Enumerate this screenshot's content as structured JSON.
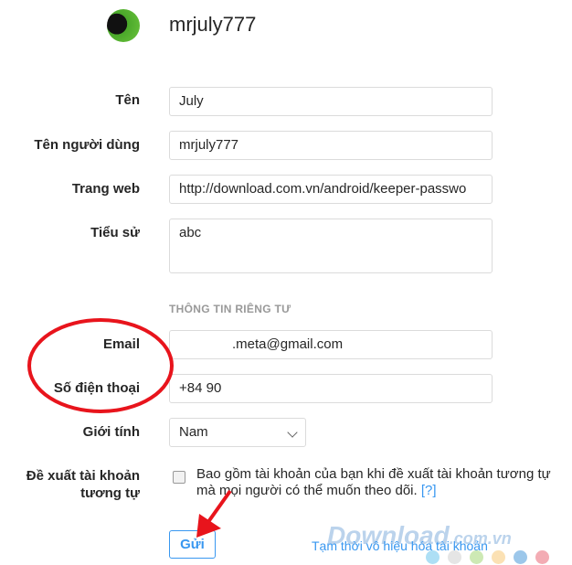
{
  "profile": {
    "username": "mrjuly777"
  },
  "form": {
    "name": {
      "label": "Tên",
      "value": "July"
    },
    "username": {
      "label": "Tên người dùng",
      "value": "mrjuly777"
    },
    "website": {
      "label": "Trang web",
      "value": "http://download.com.vn/android/keeper-passwo"
    },
    "bio": {
      "label": "Tiểu sử",
      "value": "abc"
    },
    "private_header": "THÔNG TIN RIÊNG TƯ",
    "email": {
      "label": "Email",
      "value": ".meta@gmail.com"
    },
    "phone": {
      "label": "Số điện thoại",
      "value": "+84 90"
    },
    "gender": {
      "label": "Giới tính",
      "value": "Nam"
    },
    "suggest": {
      "label_line1": "Đề xuất tài khoản",
      "label_line2": "tương tự",
      "text": "Bao gồm tài khoản của bạn khi đề xuất tài khoản tương tự mà mọi người có thể muốn theo dõi.",
      "help": "[?]",
      "checked": false
    },
    "submit_label": "Gửi",
    "disable_link": "Tạm thời vô hiệu hóa tài khoản"
  },
  "annotations": {
    "highlight_color": "#e8141c"
  },
  "watermark": {
    "text": "Download",
    "suffix": ".com.vn"
  }
}
